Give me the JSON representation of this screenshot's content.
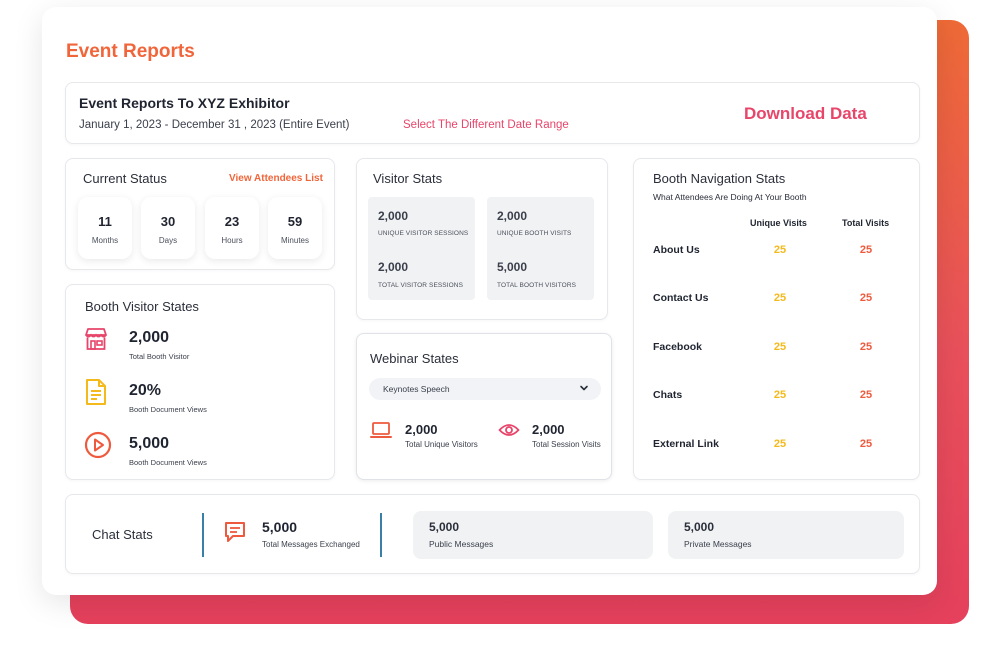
{
  "page": {
    "title": "Event Reports"
  },
  "header": {
    "title": "Event Reports To XYZ Exhibitor",
    "date_range": "January 1, 2023 - December 31 , 2023 (Entire Event)",
    "select_range_link": "Select The Different Date Range",
    "download_label": "Download Data"
  },
  "current_status": {
    "title": "Current Status",
    "link": "View Attendees List",
    "items": [
      {
        "value": "11",
        "label": "Months"
      },
      {
        "value": "30",
        "label": "Days"
      },
      {
        "value": "23",
        "label": "Hours"
      },
      {
        "value": "59",
        "label": "Minutes"
      }
    ]
  },
  "visitor_stats": {
    "title": "Visitor Stats",
    "boxes": [
      {
        "top_value": "2,000",
        "top_label": "UNIQUE VISITOR SESSIONS",
        "bottom_value": "2,000",
        "bottom_label": "TOTAL VISITOR SESSIONS"
      },
      {
        "top_value": "2,000",
        "top_label": "UNIQUE BOOTH VISITS",
        "bottom_value": "5,000",
        "bottom_label": "TOTAL BOOTH VISITORS"
      }
    ]
  },
  "booth_visitor": {
    "title": "Booth Visitor States",
    "items": [
      {
        "icon": "store-icon",
        "value": "2,000",
        "label": "Total Booth Visitor",
        "color": "#e8456a"
      },
      {
        "icon": "document-icon",
        "value": "20%",
        "label": "Booth Document Views",
        "color": "#f4b91b"
      },
      {
        "icon": "play-circle-icon",
        "value": "5,000",
        "label": "Booth Document Views",
        "color": "#ef5a3e"
      }
    ]
  },
  "webinar": {
    "title": "Webinar States",
    "selected_option": "Keynotes Speech",
    "items": [
      {
        "icon": "laptop-icon",
        "value": "2,000",
        "label": "Total Unique Visitors"
      },
      {
        "icon": "eye-icon",
        "value": "2,000",
        "label": "Total Session Visits"
      }
    ]
  },
  "booth_navigation": {
    "title": "Booth Navigation Stats",
    "subtitle": "What Attendees Are Doing At Your Booth",
    "col_unique": "Unique Visits",
    "col_total": "Total Visits",
    "rows": [
      {
        "label": "About Us",
        "unique": "25",
        "total": "25"
      },
      {
        "label": "Contact Us",
        "unique": "25",
        "total": "25"
      },
      {
        "label": "Facebook",
        "unique": "25",
        "total": "25"
      },
      {
        "label": "Chats",
        "unique": "25",
        "total": "25"
      },
      {
        "label": "External Link",
        "unique": "25",
        "total": "25"
      }
    ]
  },
  "chat_stats": {
    "title": "Chat Stats",
    "total_value": "5,000",
    "total_label": "Total Messages Exchanged",
    "public_value": "5,000",
    "public_label": "Public Messages",
    "private_value": "5,000",
    "private_label": "Private Messages"
  },
  "colors": {
    "accent_orange": "#f0653a",
    "accent_pink": "#e8456a",
    "accent_yellow": "#f4b91b"
  }
}
